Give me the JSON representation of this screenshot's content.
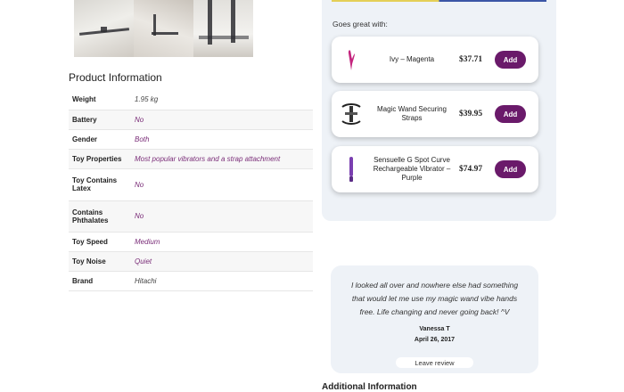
{
  "gallery": {
    "images": [
      "bed-restraint-photo",
      "pillow-strap-photo",
      "wand-strap-photo"
    ]
  },
  "product_info": {
    "title": "Product Information",
    "rows": [
      {
        "key": "Weight",
        "value": "1.95 kg"
      },
      {
        "key": "Battery",
        "value": "No"
      },
      {
        "key": "Gender",
        "value": "Both"
      },
      {
        "key": "Toy Properties",
        "value": "Most popular vibrators and a strap attachment"
      },
      {
        "key": "Toy Contains Latex",
        "value": "No"
      },
      {
        "key": "Contains Phthalates",
        "value": "No"
      },
      {
        "key": "Toy Speed",
        "value": "Medium"
      },
      {
        "key": "Toy Noise",
        "value": "Quiet"
      },
      {
        "key": "Brand",
        "value": "Hitachi"
      }
    ]
  },
  "goes_great": {
    "label": "Goes great with:",
    "items": [
      {
        "name": "Ivy – Magenta",
        "price": "$37.71",
        "button": "Add",
        "icon": "magenta-vibrator-icon"
      },
      {
        "name": "Magic Wand Securing Straps",
        "price": "$39.95",
        "button": "Add",
        "icon": "strap-icon"
      },
      {
        "name": "Sensuelle G Spot Curve Rechargeable Vibrator – Purple",
        "price": "$74.97",
        "button": "Add",
        "icon": "purple-vibrator-icon"
      }
    ]
  },
  "review": {
    "quote": "I looked all over and nowhere else had something that would let me use my magic wand vibe hands free. Life changing and never going back! ^V",
    "author": "Vanessa T",
    "date": "April 26, 2017",
    "leave_label": "Leave review"
  },
  "additional_info": {
    "heading": "Additional Information"
  },
  "colors": {
    "accent": "#6a1a6a",
    "panel": "#eef2f7",
    "value_text": "#7a2d78"
  }
}
